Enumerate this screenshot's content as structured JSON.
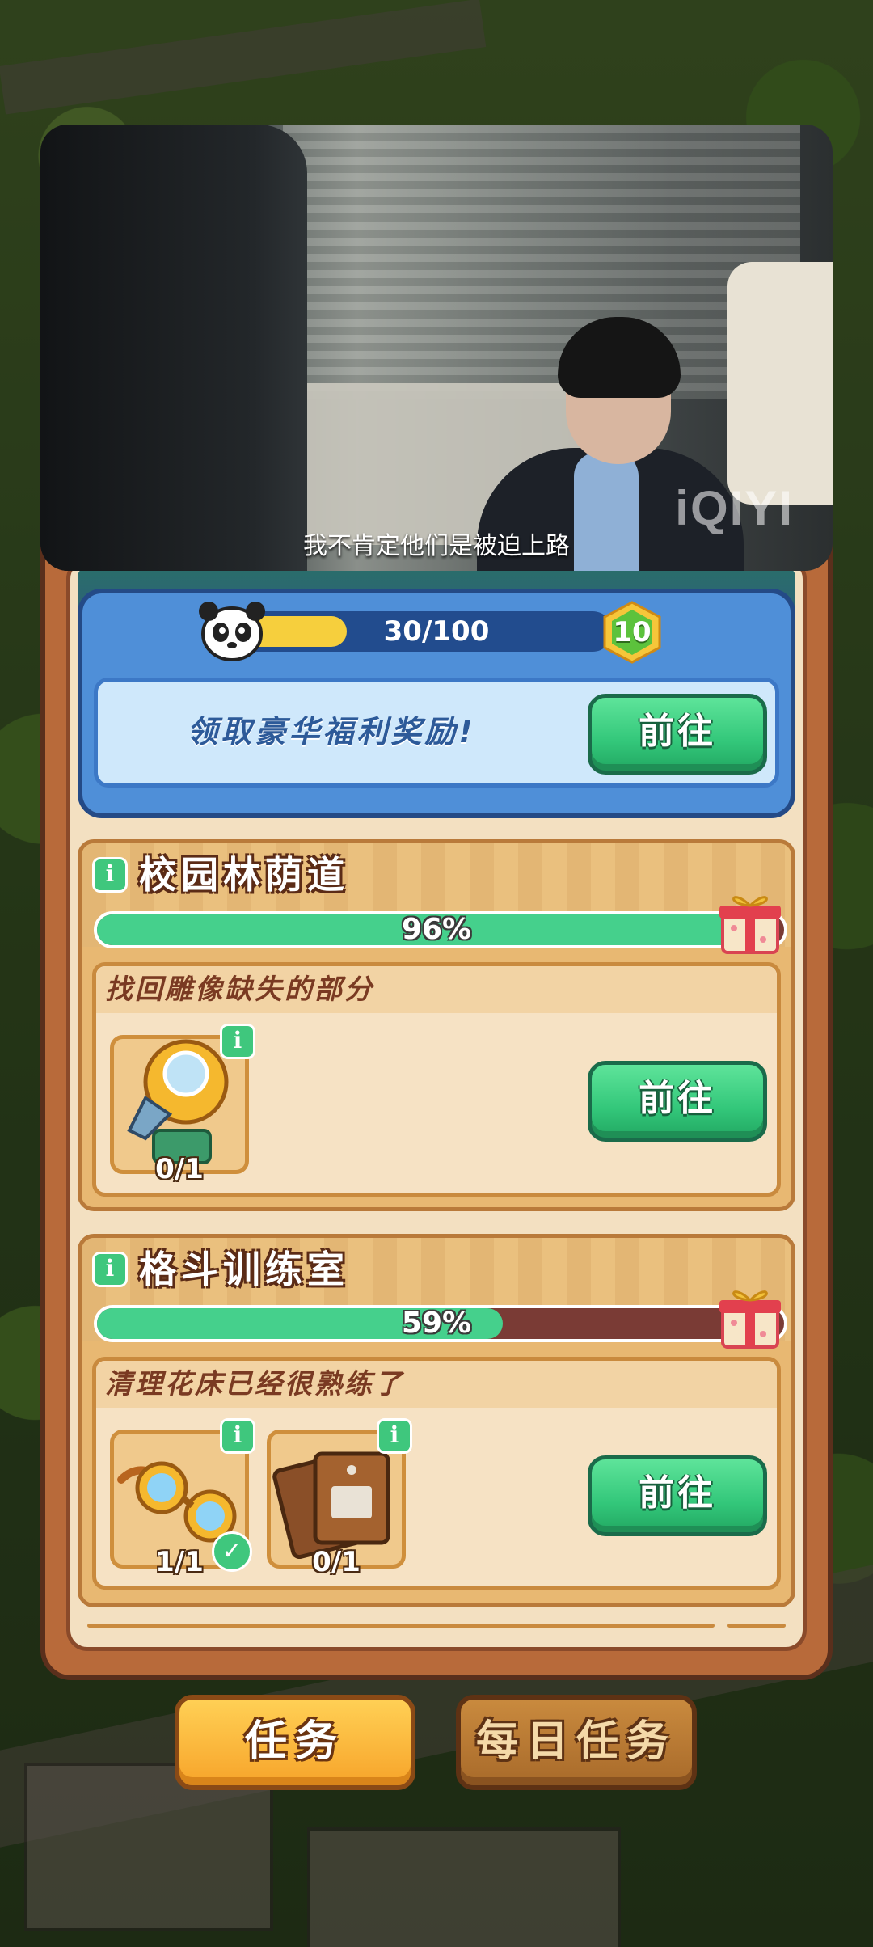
{
  "video": {
    "subtitle": "我不肯定他们是被迫上路",
    "watermark": "iQIYI"
  },
  "level": {
    "progress_text": "30/100",
    "progress_fraction": 0.3,
    "level_number": "10"
  },
  "reward": {
    "text": "领取豪华福利奖励!",
    "go_label": "前往"
  },
  "zones": [
    {
      "title": "校园林荫道",
      "progress_text": "96%",
      "progress_fraction": 0.96,
      "task_label": "找回雕像缺失的部分",
      "items": [
        {
          "icon": "golden-statue-part-icon",
          "count": "0/1",
          "done": false
        }
      ],
      "go_label": "前往"
    },
    {
      "title": "格斗训练室",
      "progress_text": "59%",
      "progress_fraction": 0.59,
      "task_label": "清理花床已经很熟练了",
      "items": [
        {
          "icon": "golden-goggles-icon",
          "count": "1/1",
          "done": true
        },
        {
          "icon": "leather-bag-icon",
          "count": "0/1",
          "done": false
        }
      ],
      "go_label": "前往"
    }
  ],
  "tabs": {
    "tasks": "任务",
    "daily_tasks": "每日任务"
  },
  "colors": {
    "go_button": "#33c77a",
    "progress_fill": "#45d08c",
    "level_bar_fill": "#f6cf3d",
    "tab_active": "#f7a42a"
  }
}
